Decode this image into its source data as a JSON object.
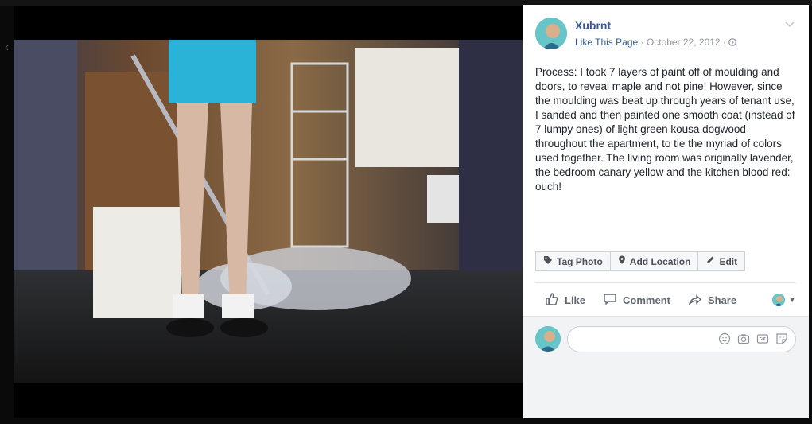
{
  "post": {
    "author": "Xubrnt",
    "like_page": "Like This Page",
    "separator": "·",
    "date": "October 22, 2012",
    "text": "Process: I took 7 layers of paint off of moulding and doors, to reveal maple and not pine! However, since the moulding was beat up through years of tenant use, I sanded and then painted one smooth coat (instead of 7 lumpy ones) of light green kousa dogwood throughout the apartment, to tie the myriad of colors used together. The living room was originally lavender, the bedroom canary yellow and the kitchen blood red: ouch!"
  },
  "tag_bar": {
    "tag_photo": "Tag Photo",
    "add_location": "Add Location",
    "edit": "Edit"
  },
  "actions": {
    "like": "Like",
    "comment": "Comment",
    "share": "Share"
  },
  "colors": {
    "link": "#365899",
    "muted": "#90949c",
    "text": "#1d2129"
  },
  "icons": [
    "globe-icon",
    "chevron-down-icon",
    "tag-icon",
    "location-pin-icon",
    "pencil-icon",
    "thumbs-up-icon",
    "speech-bubble-icon",
    "share-arrow-icon",
    "emoji-icon",
    "camera-icon",
    "gif-icon",
    "sticker-icon"
  ]
}
